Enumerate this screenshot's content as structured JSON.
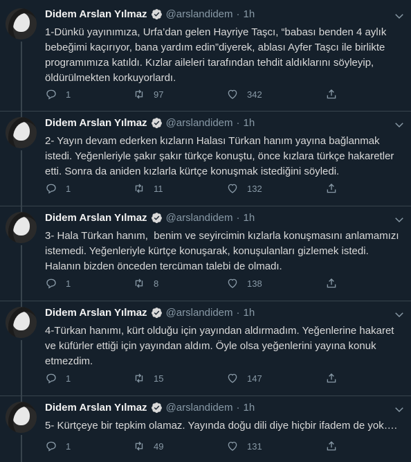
{
  "tweets": [
    {
      "name": "Didem Arslan Yılmaz",
      "handle": "@arslandidem",
      "dot": "·",
      "time": "1h",
      "text": "1-Dünkü yayınımıza, Urfa’dan gelen Hayriye Taşcı, “babası benden 4 aylık bebeğimi kaçırıyor, bana yardım edin”diyerek, ablası Ayfer Taşcı ile birlikte programımıza katıldı. Kızlar aileleri tarafından tehdit aldıklarını söyleyip, öldürülmekten korkuyorlardı.",
      "replies": "1",
      "retweets": "97",
      "likes": "342"
    },
    {
      "name": "Didem Arslan Yılmaz",
      "handle": "@arslandidem",
      "dot": "·",
      "time": "1h",
      "text": "2- Yayın devam ederken kızların Halası Türkan hanım yayına bağlanmak istedi. Yeğenleriyle şakır şakır türkçe konuştu, önce kızlara türkçe hakaretler etti. Sonra da aniden kızlarla kürtçe konuşmak istediğini söyledi.",
      "replies": "1",
      "retweets": "11",
      "likes": "132"
    },
    {
      "name": "Didem Arslan Yılmaz",
      "handle": "@arslandidem",
      "dot": "·",
      "time": "1h",
      "text": "3- Hala Türkan hanım,  benim ve seyircimin kızlarla konuşmasını anlamamızı istemedi. Yeğenleriyle kürtçe konuşarak, konuşulanları gizlemek istedi. Halanın bizden önceden tercüman talebi de olmadı.",
      "replies": "1",
      "retweets": "8",
      "likes": "138"
    },
    {
      "name": "Didem Arslan Yılmaz",
      "handle": "@arslandidem",
      "dot": "·",
      "time": "1h",
      "text": "4-Türkan hanımı, kürt olduğu için yayından aldırmadım. Yeğenlerine hakaret ve küfürler ettiği için yayından aldım. Öyle olsa yeğenlerini yayına konuk etmezdim.",
      "replies": "1",
      "retweets": "15",
      "likes": "147"
    },
    {
      "name": "Didem Arslan Yılmaz",
      "handle": "@arslandidem",
      "dot": "·",
      "time": "1h",
      "text": "5- Kürtçeye bir tepkim olamaz. Yayında doğu dili diye hiçbir ifadem de yok….",
      "replies": "1",
      "retweets": "49",
      "likes": "131"
    }
  ],
  "colors": {
    "background": "#15202b",
    "text": "#d9d9d9",
    "muted": "#8899a6",
    "verified": "#d9d9d9",
    "divider": "#38444d"
  },
  "icons": [
    "verified-badge-icon",
    "chevron-down-icon",
    "reply-icon",
    "retweet-icon",
    "like-icon",
    "share-icon"
  ]
}
